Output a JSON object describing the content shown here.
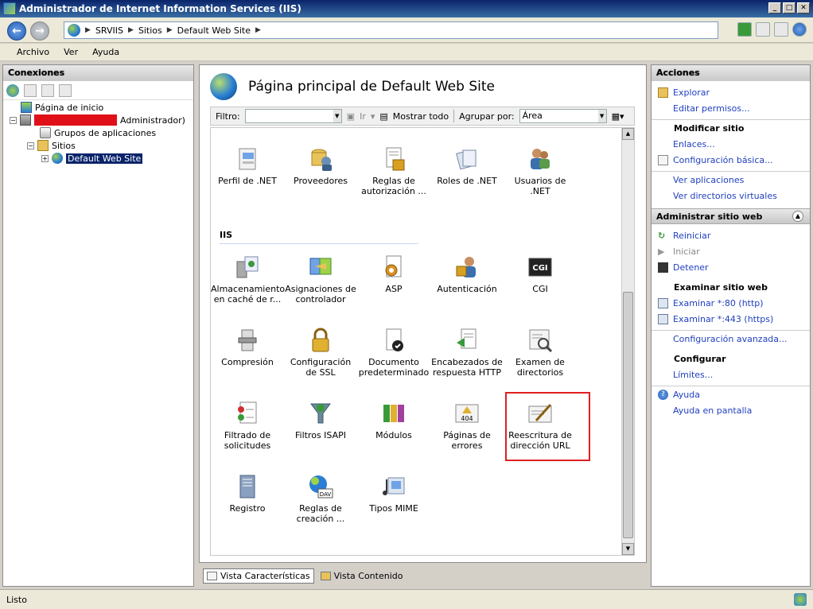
{
  "window": {
    "title": "Administrador de Internet Information Services (IIS)"
  },
  "address": {
    "crumbs": [
      "SRVIIS",
      "Sitios",
      "Default Web Site"
    ]
  },
  "menu": [
    "Archivo",
    "Ver",
    "Ayuda"
  ],
  "connections": {
    "title": "Conexiones",
    "tree": {
      "home": "Página de inicio",
      "server_suffix": "Administrador)",
      "app_pools": "Grupos de aplicaciones",
      "sites": "Sitios",
      "site": "Default Web Site"
    }
  },
  "main": {
    "title": "Página principal de Default Web Site",
    "filter": {
      "label": "Filtro:",
      "go": "Ir",
      "show_all": "Mostrar todo",
      "group_by_label": "Agrupar por:",
      "group_by_value": "Área"
    },
    "section_iis": "IIS",
    "features_top": [
      "Perfil de .NET",
      "Proveedores",
      "Reglas de autorización ...",
      "Roles de .NET",
      "Usuarios de .NET"
    ],
    "features_row1": [
      "Almacenamiento en caché de r...",
      "Asignaciones de controlador",
      "ASP",
      "Autenticación",
      "CGI"
    ],
    "features_row2": [
      "Compresión",
      "Configuración de SSL",
      "Documento predeterminado",
      "Encabezados de respuesta HTTP",
      "Examen de directorios"
    ],
    "features_row3": [
      "Filtrado de solicitudes",
      "Filtros ISAPI",
      "Módulos",
      "Páginas de errores",
      "Reescritura de dirección URL"
    ],
    "features_row4": [
      "Registro",
      "Reglas de creación ...",
      "Tipos MIME"
    ],
    "icon_labels": {
      "cgi": "CGI",
      "dav": "DAV",
      "err": "404"
    }
  },
  "viewtabs": {
    "features": "Vista Características",
    "content": "Vista Contenido"
  },
  "actions": {
    "title": "Acciones",
    "explore": "Explorar",
    "edit_perms": "Editar permisos...",
    "edit_site_hdr": "Modificar sitio",
    "bindings": "Enlaces...",
    "basic_settings": "Configuración básica...",
    "view_apps": "Ver aplicaciones",
    "view_vdirs": "Ver directorios virtuales",
    "manage_hdr": "Administrar sitio web",
    "restart": "Reiniciar",
    "start": "Iniciar",
    "stop": "Detener",
    "browse_hdr": "Examinar sitio web",
    "browse80": "Examinar *:80 (http)",
    "browse443": "Examinar *:443 (https)",
    "advanced": "Configuración avanzada...",
    "configure_hdr": "Configurar",
    "limits": "Límites...",
    "help": "Ayuda",
    "online_help": "Ayuda en pantalla"
  },
  "status": {
    "text": "Listo"
  }
}
